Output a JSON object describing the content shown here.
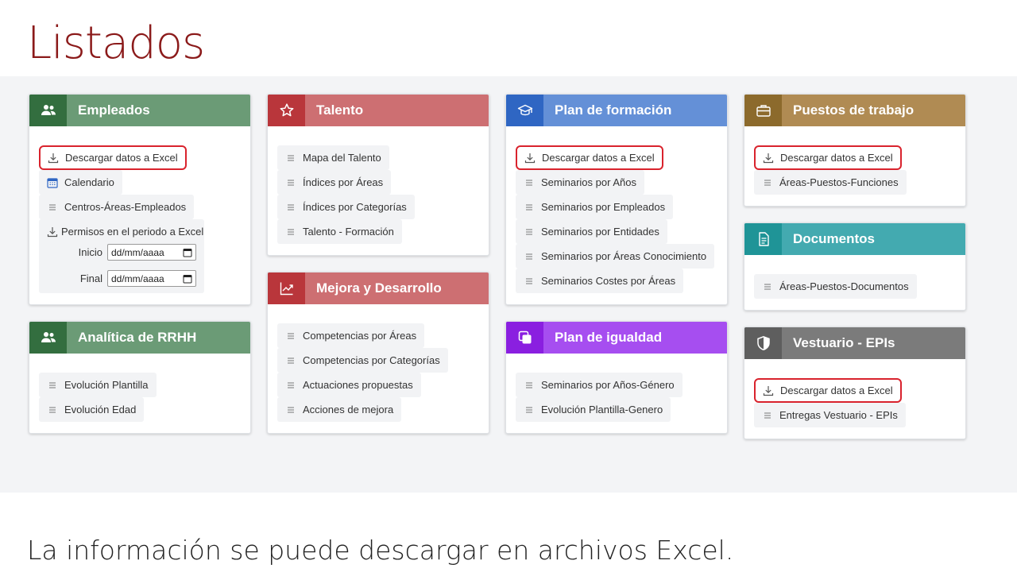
{
  "slide": {
    "title": "Listados",
    "caption": "La información se puede descargar en archivos Excel."
  },
  "colors": {
    "empleados": {
      "dark": "#336e3f",
      "light": "#6b9b76"
    },
    "analitica": {
      "dark": "#336e3f",
      "light": "#6b9b76"
    },
    "talento": {
      "dark": "#b9363b",
      "light": "#cd6f72"
    },
    "mejora": {
      "dark": "#b9363b",
      "light": "#cd6f72"
    },
    "formacion": {
      "dark": "#2f66c3",
      "light": "#6490d7"
    },
    "igualdad": {
      "dark": "#8a1fe0",
      "light": "#a64ef0"
    },
    "puestos": {
      "dark": "#8c6a2c",
      "light": "#b08b53"
    },
    "documentos": {
      "dark": "#1f9497",
      "light": "#43aab0"
    },
    "vestuario": {
      "dark": "#5e5e5e",
      "light": "#7b7b7b"
    },
    "highlight": "#d9232d"
  },
  "cards": {
    "empleados": {
      "title": "Empleados",
      "icon": "users-icon",
      "items": [
        "Descargar datos a Excel",
        "Calendario",
        "Centros-Áreas-Empleados"
      ],
      "permisos": {
        "title": "Permisos en el periodo a Excel",
        "inicio_label": "Inicio",
        "final_label": "Final",
        "inicio_placeholder": "dd/mm/aaaa",
        "final_placeholder": "dd/mm/aaaa"
      }
    },
    "analitica": {
      "title": "Analítica de RRHH",
      "icon": "users-icon",
      "items": [
        "Evolución Plantilla",
        "Evolución Edad"
      ]
    },
    "talento": {
      "title": "Talento",
      "icon": "star-icon",
      "items": [
        "Mapa del Talento",
        "Índices por Áreas",
        "Índices por Categorías",
        "Talento - Formación"
      ]
    },
    "mejora": {
      "title": "Mejora y Desarrollo",
      "icon": "trend-chart-icon",
      "items": [
        "Competencias por Áreas",
        "Competencias por Categorías",
        "Actuaciones propuestas",
        "Acciones de mejora"
      ]
    },
    "formacion": {
      "title": "Plan de formación",
      "icon": "graduation-cap-icon",
      "items": [
        "Descargar datos a Excel",
        "Seminarios por Años",
        "Seminarios por Empleados",
        "Seminarios por Entidades",
        "Seminarios por Áreas Conocimiento",
        "Seminarios Costes por Áreas"
      ]
    },
    "igualdad": {
      "title": "Plan de igualdad",
      "icon": "overlap-squares-icon",
      "items": [
        "Seminarios por Años-Género",
        "Evolución Plantilla-Genero"
      ]
    },
    "puestos": {
      "title": "Puestos de trabajo",
      "icon": "briefcase-icon",
      "items": [
        "Descargar datos a Excel",
        "Áreas-Puestos-Funciones"
      ]
    },
    "documentos": {
      "title": "Documentos",
      "icon": "document-icon",
      "items": [
        "Áreas-Puestos-Documentos"
      ]
    },
    "vestuario": {
      "title": "Vestuario - EPIs",
      "icon": "shield-icon",
      "items": [
        "Descargar datos a Excel",
        "Entregas Vestuario - EPIs"
      ]
    }
  }
}
